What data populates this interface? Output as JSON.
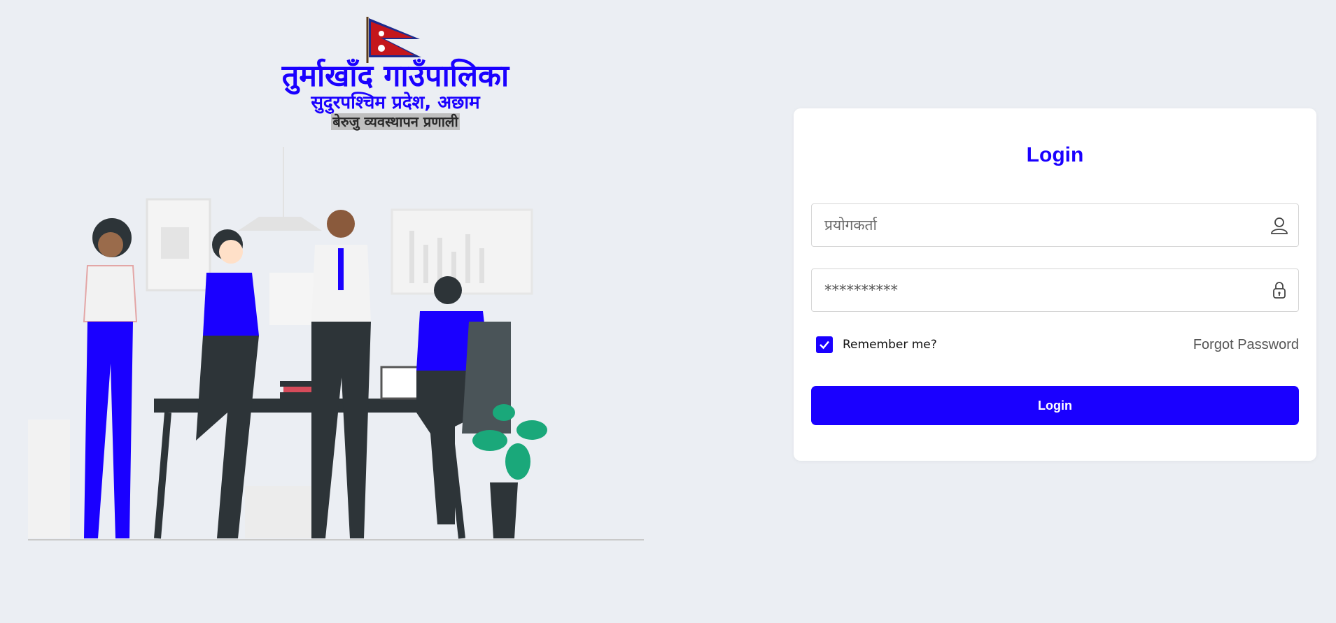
{
  "branding": {
    "municipality": "तुर्माखाँद गाउँपालिका",
    "province": "सुदुरपश्चिम प्रदेश, अछाम",
    "system": "बेरुजु व्यवस्थापन प्रणाली",
    "flag_icon": "nepal-flag-icon",
    "illustration": "office-team-illustration"
  },
  "login": {
    "title": "Login",
    "username_placeholder": "प्रयोगकर्ता",
    "password_value": "**********",
    "remember_label": "Remember me?",
    "remember_checked": true,
    "forgot_label": "Forgot Password",
    "submit_label": "Login",
    "user_icon": "user-icon",
    "lock_icon": "lock-icon"
  },
  "colors": {
    "accent": "#1a00ff",
    "background": "#ebeef3",
    "card": "#ffffff"
  }
}
